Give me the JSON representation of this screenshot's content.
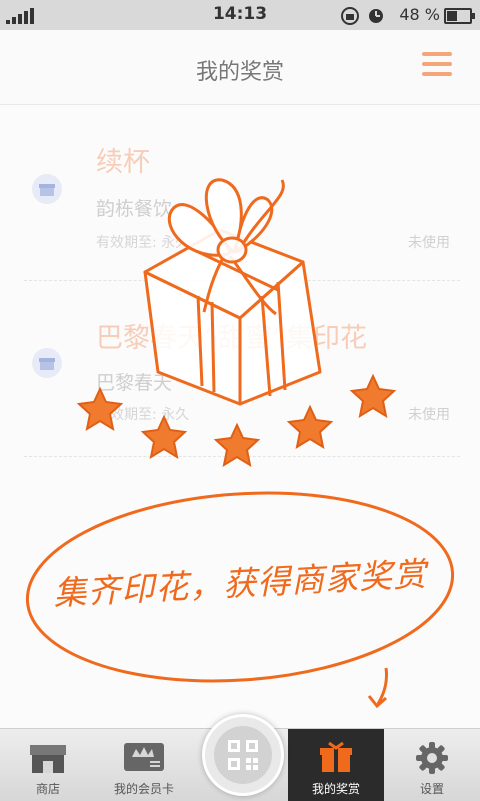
{
  "status_bar": {
    "time": "14:13",
    "battery": "48 %"
  },
  "header": {
    "title": "我的奖赏"
  },
  "rewards": [
    {
      "title": "续杯",
      "shop": "韵栋餐饮",
      "validity": "有效期至: 永久",
      "status": "未使用"
    },
    {
      "title": "巴黎春天“甜蜜”集印花",
      "shop": "巴黎春天",
      "validity": "有效期至: 永久",
      "status": "未使用"
    }
  ],
  "overlay": {
    "caption": "集齐印花，获得商家奖赏"
  },
  "tabbar": {
    "shop": "商店",
    "member_card": "我的会员卡",
    "rewards": "我的奖赏",
    "settings": "设置"
  },
  "colors": {
    "accent": "#ef6a1c",
    "tab_active": "#2b2b2b"
  }
}
